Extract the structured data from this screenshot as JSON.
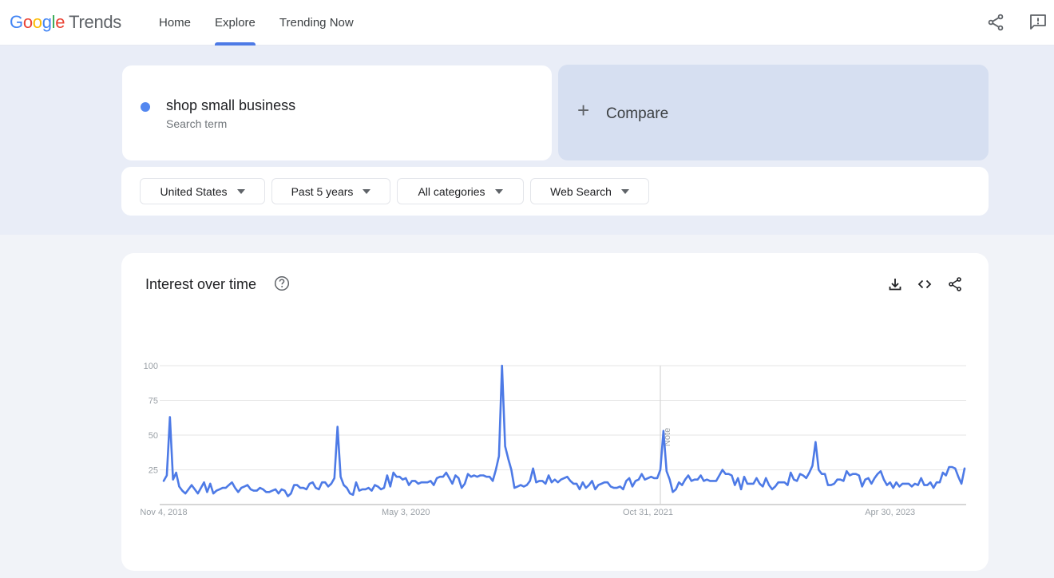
{
  "header": {
    "logo": {
      "google_letters": [
        "G",
        "o",
        "o",
        "g",
        "l",
        "e"
      ],
      "product": "Trends"
    },
    "nav": [
      {
        "label": "Home",
        "active": false
      },
      {
        "label": "Explore",
        "active": true
      },
      {
        "label": "Trending Now",
        "active": false
      }
    ],
    "icons": {
      "share": "share-icon",
      "feedback": "feedback-icon"
    }
  },
  "search": {
    "term": "shop small business",
    "term_subtitle": "Search term",
    "term_color": "#5387f0",
    "compare_label": "Compare",
    "compare_icon": "plus-icon"
  },
  "filters": [
    {
      "label": "United States"
    },
    {
      "label": "Past 5 years"
    },
    {
      "label": "All categories"
    },
    {
      "label": "Web Search"
    }
  ],
  "interest_card": {
    "title": "Interest over time",
    "help_icon": "help-circle-icon",
    "actions": [
      "download-icon",
      "embed-code-icon",
      "share-icon"
    ]
  },
  "chart_data": {
    "type": "line",
    "title": "Interest over time",
    "xlabel": "",
    "ylabel": "",
    "ylim": [
      0,
      100
    ],
    "yticks": [
      25,
      50,
      75,
      100
    ],
    "grid": true,
    "x_tick_labels": [
      {
        "label": "Nov 4, 2018",
        "index": 0
      },
      {
        "label": "May 3, 2020",
        "index": 78
      },
      {
        "label": "Oct 31, 2021",
        "index": 156
      },
      {
        "label": "Apr 30, 2023",
        "index": 234
      }
    ],
    "annotation": {
      "label": "Note",
      "index": 160
    },
    "line_color": "#4d7ae6",
    "series": [
      {
        "name": "shop small business",
        "values": [
          17,
          21,
          63,
          18,
          23,
          13,
          10,
          8,
          11,
          14,
          11,
          8,
          12,
          16,
          9,
          15,
          8,
          10,
          11,
          12,
          12,
          14,
          16,
          12,
          9,
          12,
          13,
          14,
          11,
          10,
          10,
          12,
          11,
          9,
          9,
          10,
          11,
          8,
          11,
          10,
          6,
          8,
          14,
          14,
          12,
          12,
          11,
          15,
          16,
          12,
          11,
          16,
          16,
          13,
          15,
          19,
          56,
          20,
          14,
          12,
          8,
          7,
          16,
          10,
          11,
          11,
          12,
          10,
          14,
          13,
          11,
          12,
          21,
          13,
          23,
          20,
          20,
          18,
          19,
          14,
          17,
          17,
          15,
          16,
          16,
          16,
          17,
          14,
          19,
          20,
          20,
          23,
          19,
          15,
          21,
          19,
          12,
          15,
          22,
          20,
          21,
          20,
          21,
          21,
          20,
          20,
          17,
          25,
          35,
          100,
          42,
          33,
          25,
          12,
          13,
          14,
          13,
          14,
          17,
          26,
          16,
          17,
          17,
          15,
          21,
          16,
          18,
          16,
          18,
          19,
          20,
          17,
          15,
          15,
          11,
          16,
          12,
          14,
          17,
          11,
          14,
          15,
          16,
          16,
          13,
          12,
          12,
          13,
          11,
          17,
          19,
          13,
          17,
          18,
          22,
          18,
          19,
          20,
          19,
          19,
          25,
          53,
          24,
          18,
          9,
          11,
          16,
          14,
          18,
          21,
          17,
          18,
          18,
          21,
          17,
          18,
          17,
          17,
          17,
          21,
          25,
          22,
          22,
          21,
          14,
          19,
          11,
          20,
          15,
          15,
          15,
          19,
          15,
          13,
          19,
          14,
          11,
          13,
          16,
          16,
          16,
          14,
          23,
          18,
          17,
          22,
          21,
          19,
          23,
          28,
          45,
          25,
          22,
          22,
          14,
          14,
          15,
          18,
          18,
          17,
          24,
          21,
          22,
          22,
          21,
          13,
          18,
          19,
          15,
          19,
          22,
          24,
          18,
          14,
          16,
          12,
          16,
          13,
          15,
          15,
          15,
          13,
          15,
          14,
          19,
          14,
          14,
          16,
          12,
          16,
          16,
          23,
          21,
          27,
          27,
          26,
          20,
          15,
          26
        ]
      }
    ]
  }
}
